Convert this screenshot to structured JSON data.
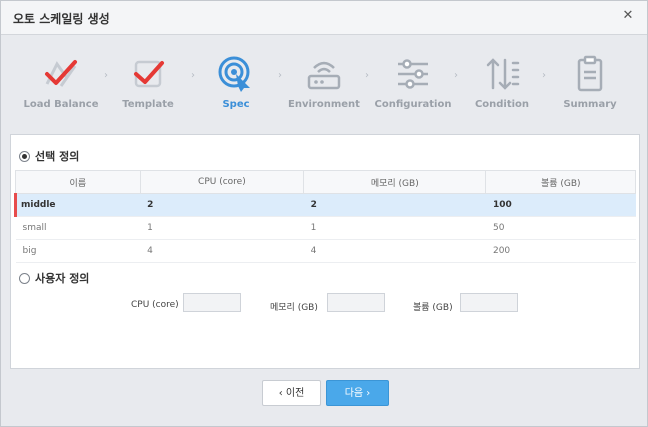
{
  "window": {
    "title": "오토 스케일링 생성"
  },
  "wizard": {
    "steps": [
      {
        "label": "Load Balance",
        "state": "done",
        "icon": "checkmark-icon"
      },
      {
        "label": "Template",
        "state": "done",
        "icon": "checkmark-icon"
      },
      {
        "label": "Spec",
        "state": "active",
        "icon": "target-cursor-icon"
      },
      {
        "label": "Environment",
        "state": "todo",
        "icon": "router-icon"
      },
      {
        "label": "Configuration",
        "state": "todo",
        "icon": "sliders-icon"
      },
      {
        "label": "Condition",
        "state": "todo",
        "icon": "sort-arrows-icon"
      },
      {
        "label": "Summary",
        "state": "todo",
        "icon": "clipboard-icon"
      }
    ]
  },
  "spec": {
    "preset_label": "선택 정의",
    "custom_label": "사용자 정의",
    "columns": [
      "이름",
      "CPU (core)",
      "메모리 (GB)",
      "볼륨 (GB)"
    ],
    "rows": [
      {
        "name": "middle",
        "cpu": "2",
        "memory": "2",
        "volume": "100",
        "selected": true
      },
      {
        "name": "small",
        "cpu": "1",
        "memory": "1",
        "volume": "50",
        "selected": false
      },
      {
        "name": "big",
        "cpu": "4",
        "memory": "4",
        "volume": "200",
        "selected": false
      }
    ],
    "custom_fields": {
      "cpu_label": "CPU (core)",
      "memory_label": "메모리 (GB)",
      "volume_label": "볼륨 (GB)"
    }
  },
  "buttons": {
    "prev_label": "‹ 이전",
    "next_label": "다음 ›"
  },
  "colors": {
    "accent": "#3b8fd8",
    "done": "#e53935",
    "selected_row": "#dcecfb",
    "row_marker": "#e74c4c"
  }
}
